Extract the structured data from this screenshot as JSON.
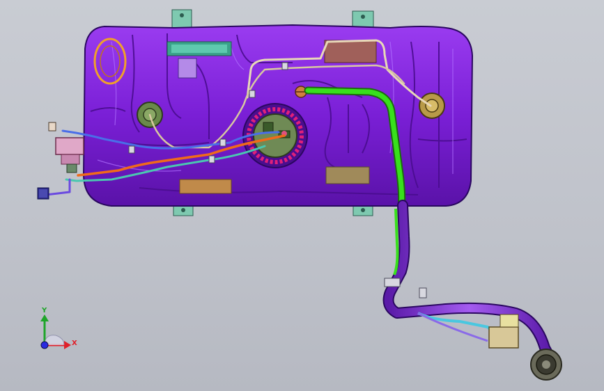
{
  "view": {
    "background_top": "#c9ccd3",
    "background_bottom": "#b6b9c2",
    "model": "fuel-tank-assembly",
    "colors": {
      "tank": "#7a1fd6",
      "tank_dark": "#4a0d8f",
      "tank_edge": "#2a0760",
      "filler_neck": "#8b3fe0",
      "fill_hose_green": "#38e01c",
      "fuel_pump_flange": "#e0207a",
      "pump_module": "#6f8a55",
      "strap_teal": "#3aa38a",
      "strap_orange": "#c08a4a",
      "bracket": "#7ec9b0",
      "line_orange": "#f06a1a",
      "line_white": "#e8d8b8",
      "line_blue": "#4a6ee8",
      "line_teal": "#4ac7b0",
      "axis_x": "#e0202a",
      "axis_y": "#1fa52a",
      "axis_z": "#2a2ae0"
    }
  },
  "triad": {
    "x_label": "X",
    "y_label": "Y"
  }
}
